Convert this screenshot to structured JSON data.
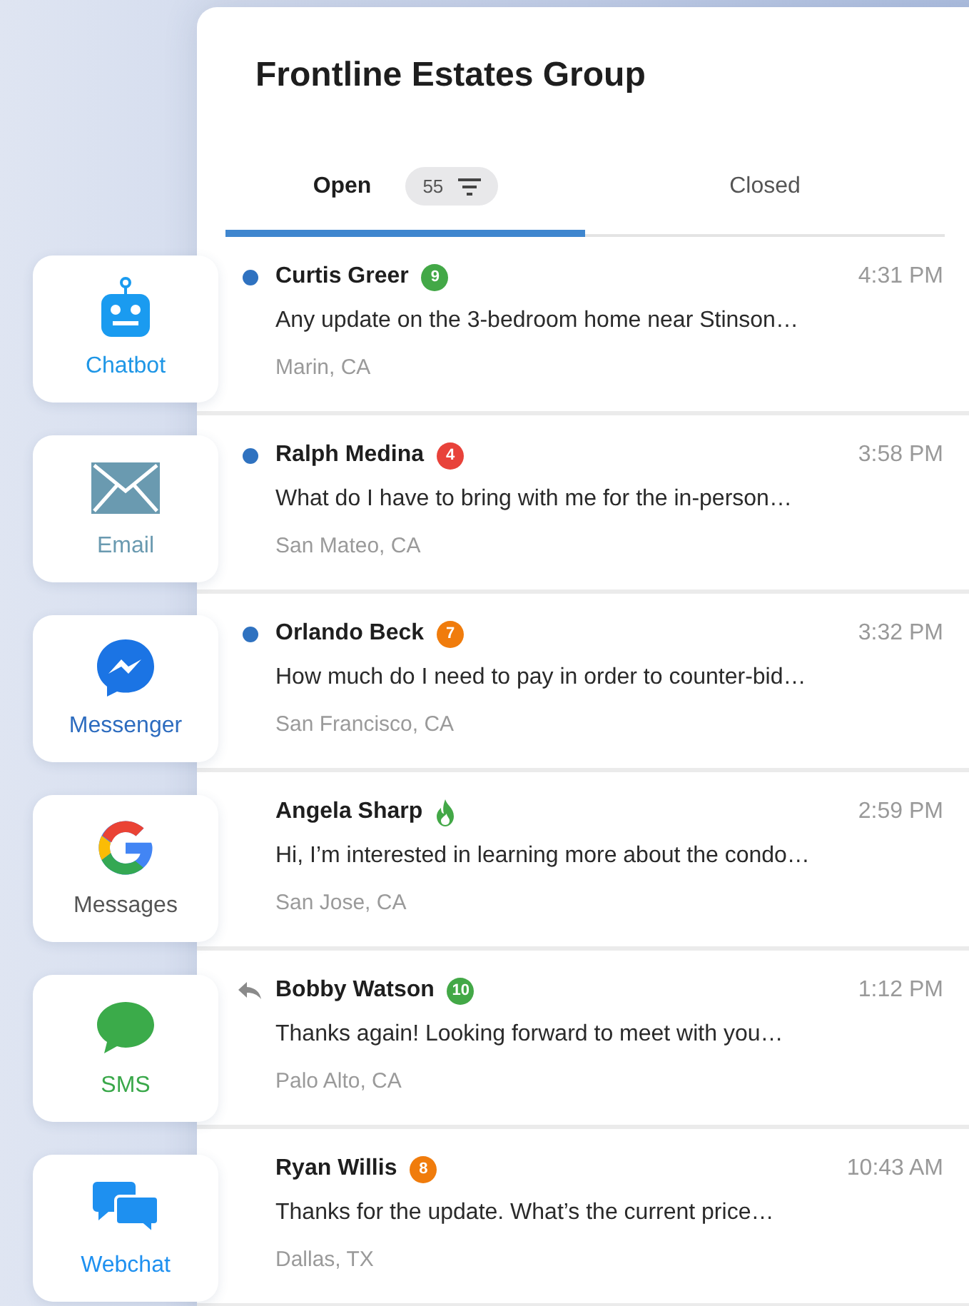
{
  "header": {
    "title": "Frontline Estates Group"
  },
  "tabs": [
    {
      "label": "Open",
      "selected": true,
      "count": "55"
    },
    {
      "label": "Closed",
      "selected": false
    }
  ],
  "conversations": [
    {
      "name": "Curtis Greer",
      "unread": true,
      "replied": false,
      "badge": {
        "kind": "count",
        "text": "9",
        "color": "#43a847"
      },
      "time": "4:31 PM",
      "message": "Any update on the 3-bedroom home near Stinson…",
      "location": "Marin, CA"
    },
    {
      "name": "Ralph Medina",
      "unread": true,
      "replied": false,
      "badge": {
        "kind": "count",
        "text": "4",
        "color": "#e8423a"
      },
      "time": "3:58 PM",
      "message": "What do I have to bring with me for the in-person…",
      "location": "San Mateo, CA"
    },
    {
      "name": "Orlando Beck",
      "unread": true,
      "replied": false,
      "badge": {
        "kind": "count",
        "text": "7",
        "color": "#f07c0c"
      },
      "time": "3:32 PM",
      "message": "How much do I need to pay in order to counter-bid…",
      "location": "San Francisco, CA"
    },
    {
      "name": "Angela Sharp",
      "unread": false,
      "replied": false,
      "badge": {
        "kind": "flame",
        "color": "#43a847"
      },
      "time": "2:59 PM",
      "message": "Hi, I’m interested in learning more about the condo…",
      "location": "San Jose, CA"
    },
    {
      "name": "Bobby Watson",
      "unread": false,
      "replied": true,
      "badge": {
        "kind": "count",
        "text": "10",
        "color": "#43a847"
      },
      "time": "1:12 PM",
      "message": "Thanks again! Looking forward to meet with you…",
      "location": "Palo Alto, CA"
    },
    {
      "name": "Ryan Willis",
      "unread": false,
      "replied": false,
      "badge": {
        "kind": "count",
        "text": "8",
        "color": "#f07c0c"
      },
      "time": "10:43 AM",
      "message": "Thanks for the update. What’s the current price…",
      "location": "Dallas, TX"
    }
  ],
  "channels": [
    {
      "kind": "chatbot",
      "label": "Chatbot",
      "color": "#1e96e6"
    },
    {
      "kind": "email",
      "label": "Email",
      "color": "#6a9ab0"
    },
    {
      "kind": "messenger",
      "label": "Messenger",
      "color": "#2d6cbf"
    },
    {
      "kind": "google",
      "label": "Messages",
      "color": "#555555"
    },
    {
      "kind": "sms",
      "label": "SMS",
      "color": "#3aa84a"
    },
    {
      "kind": "webchat",
      "label": "Webchat",
      "color": "#1e90f0"
    }
  ]
}
